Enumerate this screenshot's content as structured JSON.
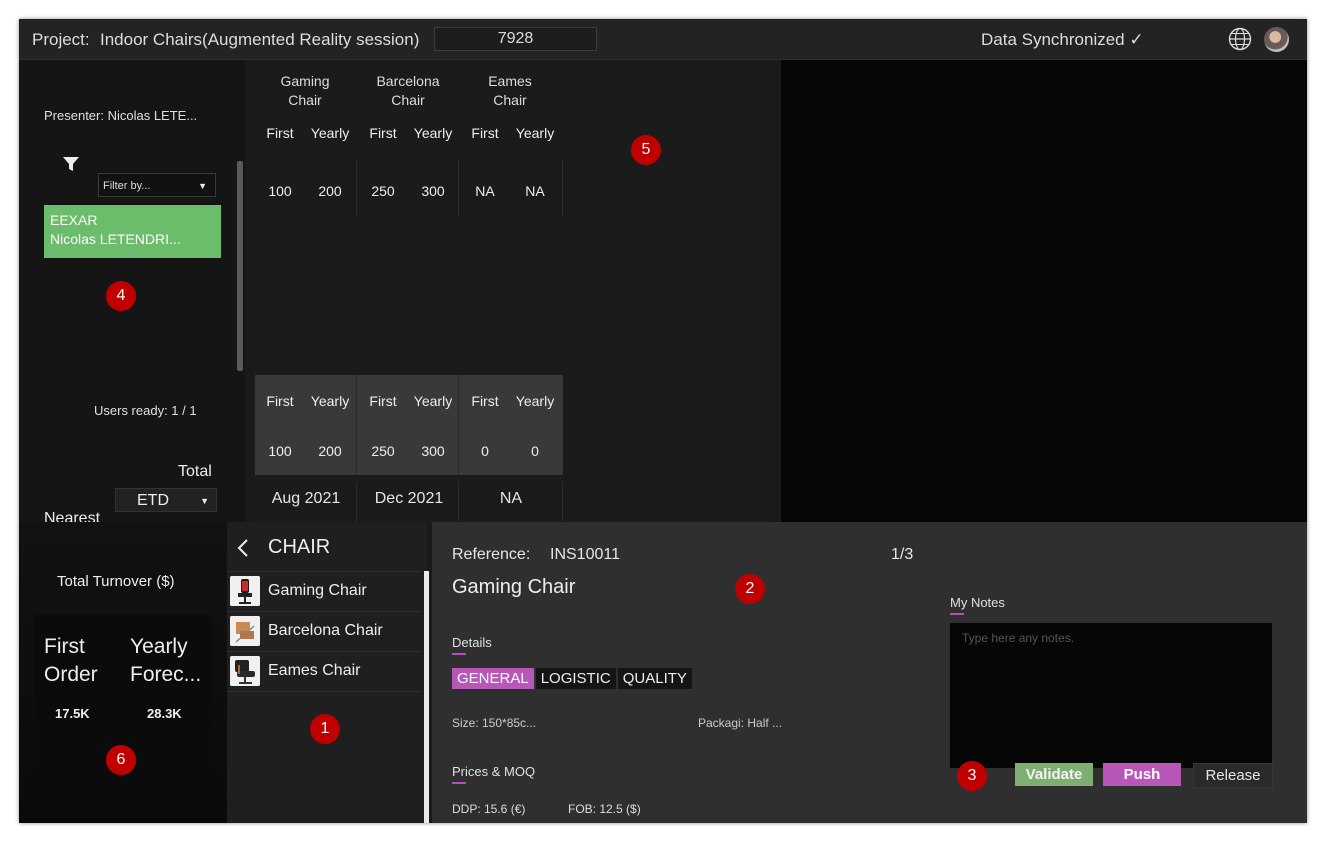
{
  "header": {
    "project_label": "Project:",
    "project_name": "Indoor Chairs(Augmented Reality session)",
    "session_id": "7928",
    "sync_status": "Data Synchronized ✓",
    "globe_icon": "globe-icon",
    "avatar_icon": "user-avatar"
  },
  "left": {
    "presenter": "Presenter: Nicolas LETE...",
    "filter_placeholder": "Filter by...",
    "user_card": {
      "line1": "EEXAR",
      "line2": "Nicolas LETENDRI..."
    },
    "users_ready": "Users ready: 1 / 1",
    "total_label": "Total",
    "nearest_label": "Nearest",
    "nearest_value": "ETD"
  },
  "table": {
    "products": [
      {
        "name1": "Gaming",
        "name2": "Chair",
        "first": "100",
        "yearly": "200",
        "total_first": "100",
        "total_yearly": "200",
        "date": "Aug 2021"
      },
      {
        "name1": "Barcelona",
        "name2": "Chair",
        "first": "250",
        "yearly": "300",
        "total_first": "250",
        "total_yearly": "300",
        "date": "Dec 2021"
      },
      {
        "name1": "Eames",
        "name2": "Chair",
        "first": "NA",
        "yearly": "NA",
        "total_first": "0",
        "total_yearly": "0",
        "date": "NA"
      }
    ],
    "col_first": "First",
    "col_yearly": "Yearly"
  },
  "turnover": {
    "title": "Total Turnover ($)",
    "first_l1": "First",
    "first_l2": "Order",
    "yearly_l1": "Yearly",
    "yearly_l2": "Forec...",
    "first_value": "17.5K",
    "yearly_value": "28.3K"
  },
  "chairlist": {
    "back_icon": "chevron-left-icon",
    "title": "CHAIR",
    "items": [
      {
        "label": "Gaming Chair"
      },
      {
        "label": "Barcelona Chair"
      },
      {
        "label": "Eames Chair"
      }
    ]
  },
  "details": {
    "reference_label": "Reference:",
    "reference_value": "INS10011",
    "pager": "1/3",
    "product_name": "Gaming Chair",
    "details_label": "Details",
    "tabs": [
      "GENERAL",
      "LOGISTIC",
      "QUALITY"
    ],
    "size": "Size:  150*85c...",
    "packaging": "Packagi:  Half ...",
    "prices_label": "Prices & MOQ",
    "ddp": "DDP:  15.6 (€)",
    "fob": "FOB:  12.5 ($)",
    "notes_label": "My Notes",
    "notes_placeholder": "Type here any notes.",
    "validate": "Validate",
    "push": "Push",
    "release": "Release"
  },
  "badges": [
    "1",
    "2",
    "3",
    "4",
    "5",
    "6"
  ],
  "colors": {
    "accent_purple": "#b857b8",
    "validate_green": "#7fae72",
    "user_card_green": "#6bbd6b",
    "badge_red": "#c00000"
  }
}
